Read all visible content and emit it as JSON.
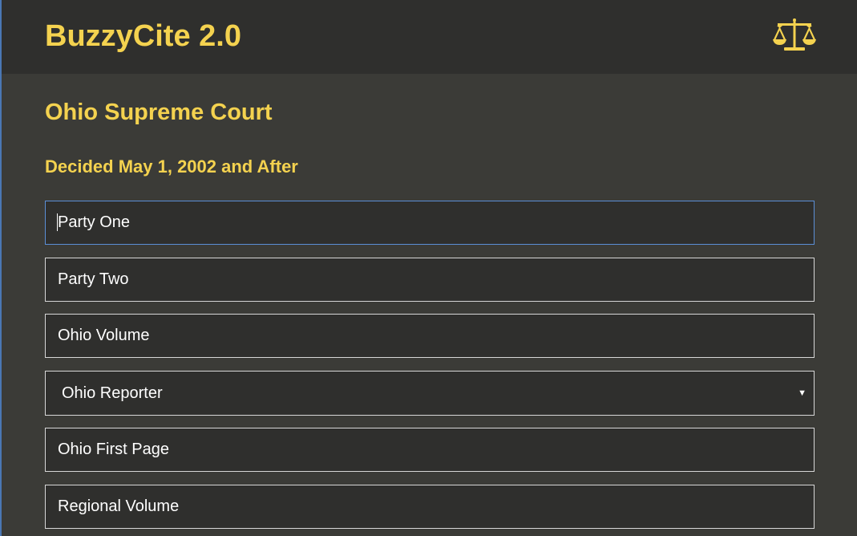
{
  "header": {
    "app_title": "BuzzyCite 2.0",
    "logo_icon": "balance-scales-icon",
    "accent_color": "#f4d24f"
  },
  "main": {
    "court_title": "Ohio Supreme Court",
    "subtitle": "Decided May 1, 2002 and After",
    "fields": {
      "party_one": {
        "placeholder": "Party One",
        "value": "",
        "focused": true
      },
      "party_two": {
        "placeholder": "Party Two",
        "value": ""
      },
      "ohio_volume": {
        "placeholder": "Ohio Volume",
        "value": ""
      },
      "ohio_reporter": {
        "selected": "Ohio Reporter",
        "icon": "chevron-down-icon"
      },
      "ohio_first_page": {
        "placeholder": "Ohio First Page",
        "value": ""
      },
      "regional_volume": {
        "placeholder": "Regional Volume",
        "value": ""
      }
    }
  }
}
